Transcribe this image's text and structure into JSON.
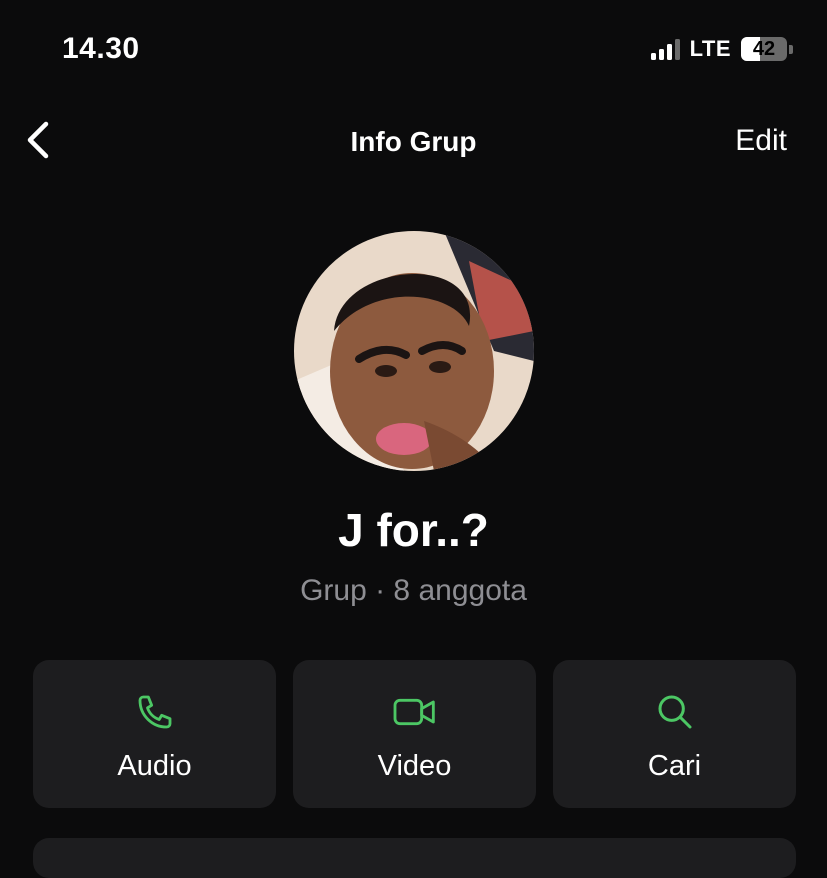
{
  "status": {
    "time": "14.30",
    "network": "LTE",
    "battery_level": "42",
    "battery_fraction": 0.42,
    "signal_bars": 3
  },
  "nav": {
    "title": "Info Grup",
    "edit_label": "Edit"
  },
  "group": {
    "name": "J for..?",
    "subtitle": "Grup · 8 anggota"
  },
  "actions": [
    {
      "label": "Audio",
      "icon": "phone-icon"
    },
    {
      "label": "Video",
      "icon": "video-camera-icon"
    },
    {
      "label": "Cari",
      "icon": "search-icon"
    }
  ],
  "colors": {
    "accent": "#4cc764",
    "background": "#0b0b0c",
    "card": "#1d1d1f",
    "secondary_text": "#8e8e93"
  }
}
